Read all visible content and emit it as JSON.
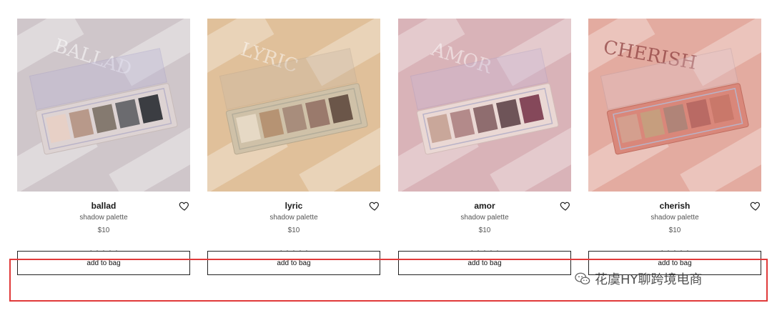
{
  "colors": {
    "accent_frame": "#e03a3a",
    "button_border": "#222222",
    "text_primary": "#1a1a1a",
    "text_secondary": "#555555"
  },
  "products": [
    {
      "name": "ballad",
      "subtitle": "shadow palette",
      "price": "$10",
      "rating": 5,
      "stars_text": "★★★★★",
      "button_label": "add to bag",
      "photo_text": "BALLAD",
      "palette_shades": [
        "#e7d0c6",
        "#b8998a",
        "#857a70",
        "#6b6b6f",
        "#3b3d42"
      ],
      "palette_bg": "#ddd3d3",
      "scene_bg": "#cfc6ca"
    },
    {
      "name": "lyric",
      "subtitle": "shadow palette",
      "price": "$10",
      "rating": 5,
      "stars_text": "★★★★★",
      "button_label": "add to bag",
      "photo_text": "LYRIC",
      "palette_shades": [
        "#e6d9c5",
        "#b69373",
        "#a88d7c",
        "#9a7a6c",
        "#6b5649"
      ],
      "palette_bg": "#cfc1a8",
      "scene_bg": "#e0c09a"
    },
    {
      "name": "amor",
      "subtitle": "shadow palette",
      "price": "$10",
      "rating": 4.5,
      "stars_text": "★★★★☆",
      "button_label": "add to bag",
      "photo_text": "AMOR",
      "palette_shades": [
        "#c9a79a",
        "#b38a8a",
        "#8f6d6f",
        "#6e5458",
        "#85485a"
      ],
      "palette_bg": "#ead8d4",
      "scene_bg": "#d9b3b8"
    },
    {
      "name": "cherish",
      "subtitle": "shadow palette",
      "price": "$10",
      "rating": 5,
      "stars_text": "★★★★★",
      "button_label": "add to bag",
      "photo_text": "CHERISH",
      "palette_shades": [
        "#d49f8e",
        "#c69e7e",
        "#b08478",
        "#b96a64",
        "#c9786a"
      ],
      "palette_bg": "#d9877a",
      "scene_bg": "#e3aba0"
    }
  ],
  "watermark": {
    "text": "花虞HY聊跨境电商"
  }
}
